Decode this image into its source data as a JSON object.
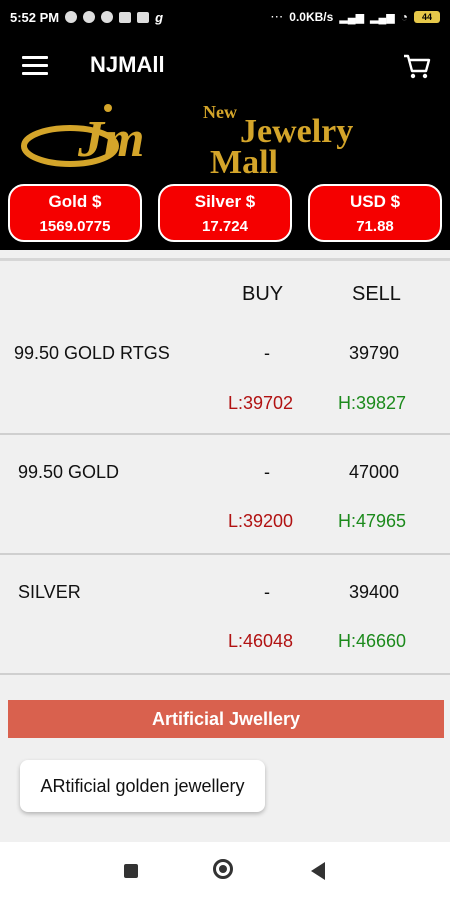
{
  "status": {
    "time": "5:52 PM",
    "speed": "0.0KB/s",
    "battery": "44"
  },
  "app": {
    "title": "NJMAll"
  },
  "banner": {
    "new": "New",
    "line1": "Jewelry",
    "line2": "Mall",
    "logo_text": "Jm"
  },
  "rates": [
    {
      "label": "Gold $",
      "value": "1569.0775"
    },
    {
      "label": "Silver $",
      "value": "17.724"
    },
    {
      "label": "USD $",
      "value": "71.88"
    }
  ],
  "table": {
    "buy_header": "BUY",
    "sell_header": "SELL",
    "rows": [
      {
        "name": "99.50 GOLD RTGS",
        "buy": "-",
        "sell": "39790",
        "low": "L:39702",
        "high": "H:39827"
      },
      {
        "name": "99.50 GOLD",
        "buy": "-",
        "sell": "47000",
        "low": "L:39200",
        "high": "H:47965"
      },
      {
        "name": "SILVER",
        "buy": "-",
        "sell": "39400",
        "low": "L:46048",
        "high": "H:46660"
      }
    ]
  },
  "section": {
    "title": "Artificial Jwellery"
  },
  "cards": [
    {
      "label": "ARtificial golden jewellery"
    }
  ],
  "colors": {
    "rate_red": "#f50000",
    "section": "#d9614e",
    "low": "#b11212",
    "high": "#1c8a1c",
    "gold": "#d4a52a"
  }
}
